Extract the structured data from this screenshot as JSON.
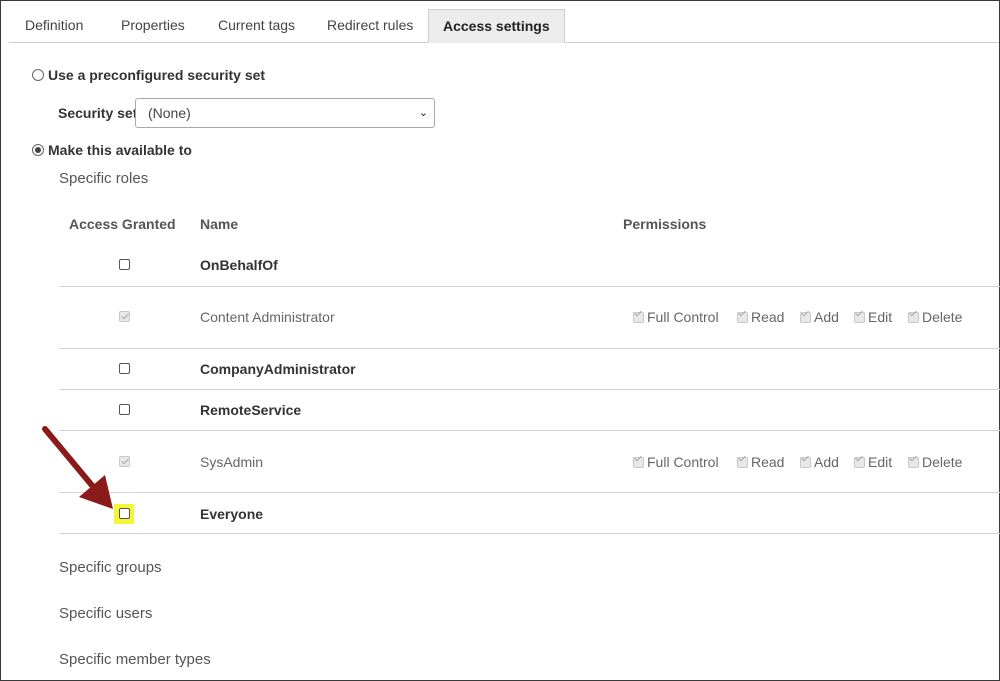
{
  "tabs": [
    {
      "label": "Definition",
      "active": false
    },
    {
      "label": "Properties",
      "active": false
    },
    {
      "label": "Current tags",
      "active": false
    },
    {
      "label": "Redirect rules",
      "active": false
    },
    {
      "label": "Access settings",
      "active": true
    }
  ],
  "security": {
    "preconfigured_label": "Use a preconfigured security set",
    "security_set_label": "Security set",
    "security_set_value": "(None)",
    "make_available_label": "Make this available to"
  },
  "roles": {
    "section_title": "Specific roles",
    "headers": {
      "access": "Access Granted",
      "name": "Name",
      "permissions": "Permissions"
    },
    "rows": [
      {
        "name": "OnBehalfOf",
        "checked": false,
        "disabled": false,
        "permissions": []
      },
      {
        "name": "Content Administrator",
        "checked": true,
        "disabled": true,
        "permissions": [
          "Full Control",
          "Read",
          "Add",
          "Edit",
          "Delete"
        ]
      },
      {
        "name": "CompanyAdministrator",
        "checked": false,
        "disabled": false,
        "permissions": []
      },
      {
        "name": "RemoteService",
        "checked": false,
        "disabled": false,
        "permissions": []
      },
      {
        "name": "SysAdmin",
        "checked": true,
        "disabled": true,
        "permissions": [
          "Full Control",
          "Read",
          "Add",
          "Edit",
          "Delete"
        ]
      },
      {
        "name": "Everyone",
        "checked": false,
        "disabled": false,
        "permissions": [],
        "highlighted": true
      }
    ]
  },
  "other_sections": {
    "groups": "Specific groups",
    "users": "Specific users",
    "member_types": "Specific member types"
  },
  "colors": {
    "highlight": "#f5f53a",
    "arrow": "#8b1a1a"
  },
  "annotation": {
    "arrow_icon": "red-arrow-annotation-icon"
  }
}
